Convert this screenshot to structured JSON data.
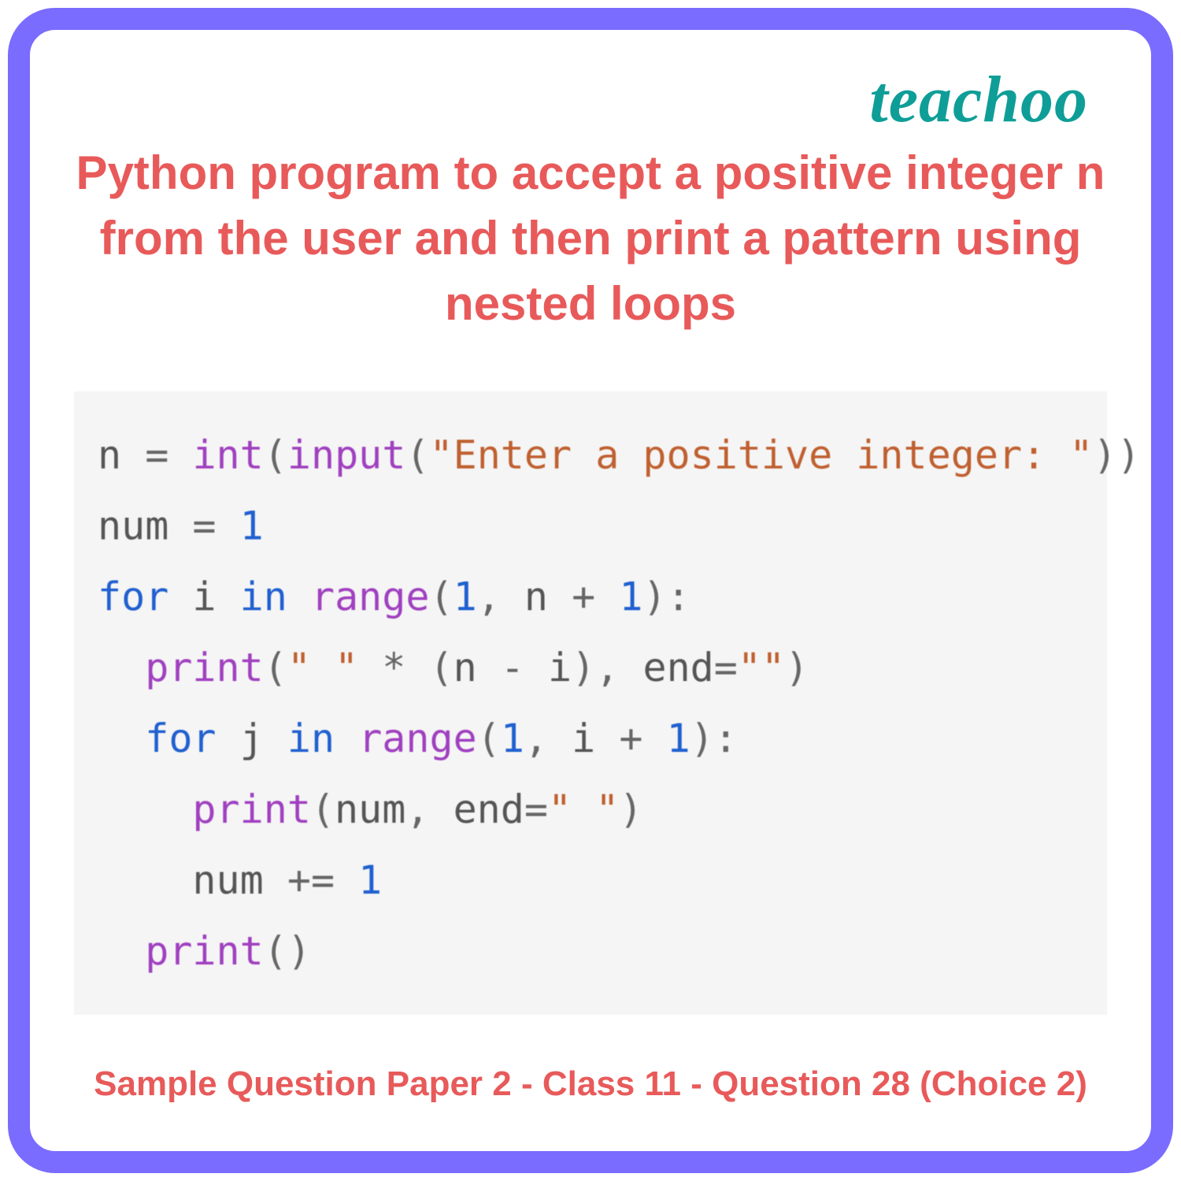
{
  "brand": "teachoo",
  "title": "Python program to accept a positive integer n from the user and then print a pattern using nested loops",
  "code": {
    "l1": {
      "a": "n ",
      "eq": "=",
      "sp": " ",
      "int": "int",
      "op1": "(",
      "inp": "input",
      "op2": "(",
      "s": "\"Enter a positive integer: \"",
      "cp": "))"
    },
    "l2": {
      "a": "num ",
      "eq": "=",
      "sp": " ",
      "n": "1"
    },
    "l3": {
      "for": "for",
      "sp1": " ",
      "i": "i",
      "sp2": " ",
      "in": "in",
      "sp3": " ",
      "rng": "range",
      "op": "(",
      "n1": "1",
      "cm": ", ",
      "id2": "n ",
      "plus": "+",
      "sp4": " ",
      "n2": "1",
      "cp": "):"
    },
    "l4": {
      "ind": "  ",
      "pr": "print",
      "op": "(",
      "s1": "\" \"",
      "sp1": " ",
      "mul": "*",
      "sp2": " ",
      "op2": "(",
      "id1": "n ",
      "minus": "-",
      "sp3": " ",
      "id2": "i",
      "cp1": ")",
      "cm": ", ",
      "end": "end",
      "eq": "=",
      "s2": "\"\"",
      "cp2": ")"
    },
    "l5": {
      "ind": "  ",
      "for": "for",
      "sp1": " ",
      "j": "j",
      "sp2": " ",
      "in": "in",
      "sp3": " ",
      "rng": "range",
      "op": "(",
      "n1": "1",
      "cm": ", ",
      "id2": "i ",
      "plus": "+",
      "sp4": " ",
      "n2": "1",
      "cp": "):"
    },
    "l6": {
      "ind": "    ",
      "pr": "print",
      "op": "(",
      "id": "num",
      "cm": ", ",
      "end": "end",
      "eq": "=",
      "s": "\" \"",
      "cp": ")"
    },
    "l7": {
      "ind": "    ",
      "id": "num ",
      "op": "+=",
      "sp": " ",
      "n": "1"
    },
    "l8": {
      "ind": "  ",
      "pr": "print",
      "pc": "()"
    }
  },
  "footer": "Sample Question Paper 2 - Class 11 - Question 28 (Choice 2)"
}
